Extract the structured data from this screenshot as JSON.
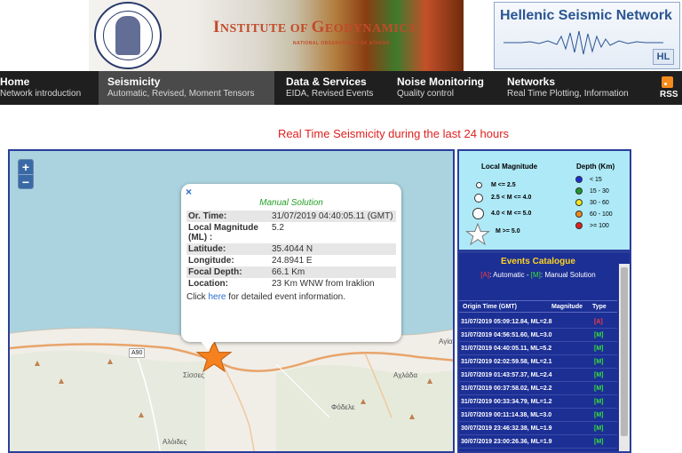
{
  "header": {
    "institute_title_big1": "I",
    "institute_title_small1": "NSTITUTE OF ",
    "institute_title_big2": "G",
    "institute_title_small2": "EODYNAMICS",
    "institute_subtitle": "NATIONAL OBSERVATORY OF ATHENS",
    "network_title": "Hellenic Seismic Network",
    "network_badge": "HL"
  },
  "nav": {
    "items": [
      {
        "title": "Home",
        "sub": "Network introduction"
      },
      {
        "title": "Seismicity",
        "sub": "Automatic, Revised, Moment Tensors"
      },
      {
        "title": "Data & Services",
        "sub": "EIDA, Revised Events"
      },
      {
        "title": "Noise Monitoring",
        "sub": "Quality control"
      },
      {
        "title": "Networks",
        "sub": "Real Time Plotting, Information"
      }
    ],
    "rss": "RSS"
  },
  "page_title": "Real Time Seismicity during the last 24 hours",
  "map": {
    "zoom_in": "+",
    "zoom_out": "−",
    "labels": {
      "road": "A90",
      "sisses": "Σίσσες",
      "achlada": "Αχλάδα",
      "fodele": "Φόδελε",
      "alodes": "Αλόιδες",
      "agia": "Αγία"
    },
    "popup": {
      "close": "×",
      "heading": "Manual Solution",
      "rows": [
        {
          "k": "Or. Time:",
          "v": "31/07/2019 04:40:05.11 (GMT)"
        },
        {
          "k": "Local Magnitude (ML) :",
          "v": "5.2"
        },
        {
          "k": "Latitude:",
          "v": "35.4044 N"
        },
        {
          "k": "Longitude:",
          "v": "24.8941 E"
        },
        {
          "k": "Focal Depth:",
          "v": "66.1 Km"
        },
        {
          "k": "Location:",
          "v": "23 Km WNW from Iraklion"
        }
      ],
      "foot_pre": "Click ",
      "foot_link": "here",
      "foot_post": " for detailed event information."
    }
  },
  "legend": {
    "mag_title": "Local Magnitude",
    "depth_title": "Depth (Km)",
    "mag_rows": [
      "M <= 2.5",
      "2.5 < M <= 4.0",
      "4.0 < M <= 5.0",
      "M >= 5.0"
    ],
    "depth_rows": [
      {
        "label": "< 15",
        "color": "#1a2dd6"
      },
      {
        "label": "15 - 30",
        "color": "#1e9a2a"
      },
      {
        "label": "30 - 60",
        "color": "#f3e51d"
      },
      {
        "label": "60 - 100",
        "color": "#f08a18"
      },
      {
        "label": ">= 100",
        "color": "#e51d1d"
      }
    ]
  },
  "catalog": {
    "title": "Events Catalogue",
    "legend_a": "[A]",
    "legend_a_text": ": Automatic - ",
    "legend_m": "[M]",
    "legend_m_text": ": Manual Solution",
    "col_time": "Origin Time (GMT)",
    "col_mag": "Magnitude",
    "col_type": "Type",
    "events": [
      {
        "d": "31/07/2019 05:09:12.84, ML=2.8",
        "t": "[A]",
        "c": "A"
      },
      {
        "d": "31/07/2019 04:56:51.60, ML=3.0",
        "t": "[M]",
        "c": "M"
      },
      {
        "d": "31/07/2019 04:40:05.11, ML=5.2",
        "t": "[M]",
        "c": "M"
      },
      {
        "d": "31/07/2019 02:02:59.58, ML=2.1",
        "t": "[M]",
        "c": "M"
      },
      {
        "d": "31/07/2019 01:43:57.37, ML=2.4",
        "t": "[M]",
        "c": "M"
      },
      {
        "d": "31/07/2019 00:37:58.02, ML=2.2",
        "t": "[M]",
        "c": "M"
      },
      {
        "d": "31/07/2019 00:33:34.79, ML=1.2",
        "t": "[M]",
        "c": "M"
      },
      {
        "d": "31/07/2019 00:11:14.38, ML=3.0",
        "t": "[M]",
        "c": "M"
      },
      {
        "d": "30/07/2019 23:46:32.38, ML=1.9",
        "t": "[M]",
        "c": "M"
      },
      {
        "d": "30/07/2019 23:00:26.36, ML=1.9",
        "t": "[M]",
        "c": "M"
      }
    ]
  }
}
